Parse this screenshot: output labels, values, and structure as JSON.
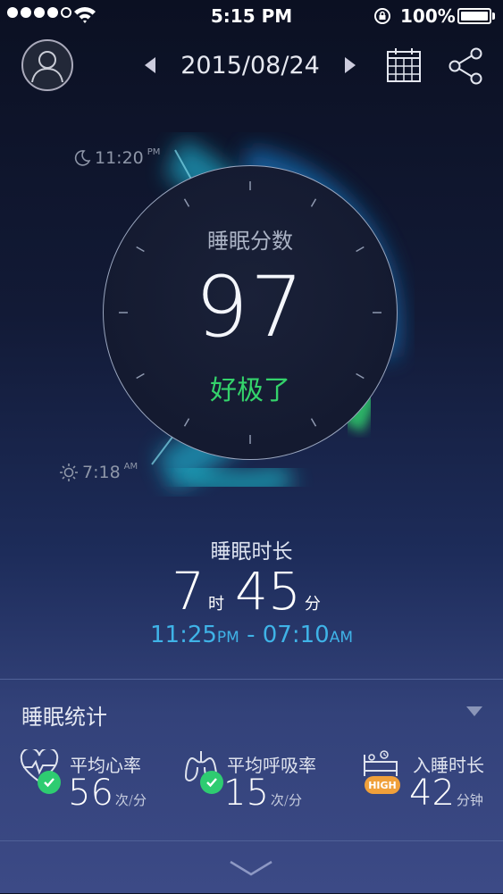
{
  "status_bar": {
    "time": "5:15 PM",
    "battery_percent": "100%",
    "signal_bars": 4,
    "signal_total": 5
  },
  "header": {
    "date": "2015/08/24",
    "icons": [
      "avatar-icon",
      "chevron-left-icon",
      "chevron-right-icon",
      "calendar-icon",
      "share-icon"
    ]
  },
  "dial": {
    "title": "睡眠分数",
    "score": "97",
    "rating": "好极了",
    "rating_color": "#34d36b",
    "sleep_start": {
      "time": "11:20",
      "ampm": "PM"
    },
    "wake_time": {
      "time": "7:18",
      "ampm": "AM"
    }
  },
  "duration": {
    "title": "睡眠时长",
    "hours": "7",
    "hours_unit": "时",
    "minutes": "45",
    "minutes_unit": "分",
    "start": "11:25",
    "start_ampm": "PM",
    "separator": " - ",
    "end": "07:10",
    "end_ampm": "AM",
    "range_color": "#3fb3e7"
  },
  "stats": {
    "title": "睡眠统计",
    "items": [
      {
        "label": "平均心率",
        "value": "56",
        "unit": "次/分",
        "icon": "heart-rate-icon",
        "badge": "check"
      },
      {
        "label": "平均呼吸率",
        "value": "15",
        "unit": "次/分",
        "icon": "lungs-icon",
        "badge": "check"
      },
      {
        "label": "入睡时长",
        "value": "42",
        "unit": "分钟",
        "icon": "bed-icon",
        "badge_text": "HIGH"
      }
    ]
  }
}
